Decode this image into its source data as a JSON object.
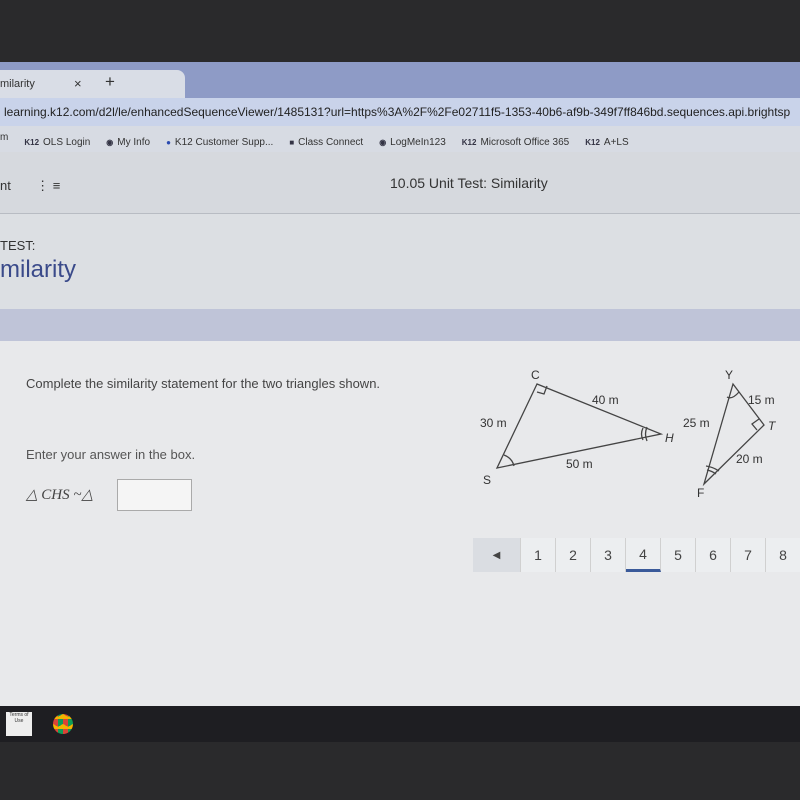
{
  "browser": {
    "tab_title": "milarity",
    "tab_close": "×",
    "new_tab": "+",
    "url": "learning.k12.com/d2l/le/enhancedSequenceViewer/1485131?url=https%3A%2F%2Fe02711f5-1353-40b6-af9b-349f7ff846bd.sequences.api.brightsp",
    "bookmarks": [
      {
        "icon": "K12",
        "label": "OLS Login"
      },
      {
        "icon": "globe-icon",
        "label": "My Info"
      },
      {
        "icon": "chat-icon",
        "label": "K12 Customer Supp..."
      },
      {
        "icon": "square-icon",
        "label": "Class Connect"
      },
      {
        "icon": "globe-icon",
        "label": "LogMeIn123"
      },
      {
        "icon": "K12",
        "label": "Microsoft Office 365"
      },
      {
        "icon": "K12",
        "label": "A+LS"
      }
    ],
    "bookmark_lead": "m"
  },
  "header": {
    "left": "nt",
    "menu": "⋮  ≡",
    "title": "10.05 Unit Test: Similarity"
  },
  "page": {
    "eyebrow": "TEST:",
    "title": "milarity"
  },
  "question": {
    "prompt": "Complete the similarity statement for the two triangles shown.",
    "instruction": "Enter your answer in the box.",
    "statement": "△ CHS ~△",
    "answer": ""
  },
  "figure": {
    "t1": {
      "C": "C",
      "S": "S",
      "H": "H",
      "CS": "30 m",
      "CH": "40 m",
      "SH": "50 m"
    },
    "t2": {
      "Y": "Y",
      "T": "T",
      "F": "F",
      "YT": "15 m",
      "YF": "25 m",
      "TF": "20 m"
    }
  },
  "pager": {
    "prev": "◀",
    "pages": [
      "1",
      "2",
      "3",
      "4",
      "5",
      "6",
      "7",
      "8"
    ],
    "current": "4"
  },
  "taskbar": {
    "terms": "Terms of Use"
  }
}
